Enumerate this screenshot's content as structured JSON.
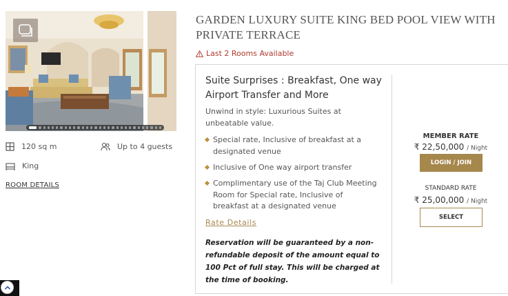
{
  "room": {
    "title": "GARDEN LUXURY SUITE KING BED POOL VIEW WITH PRIVATE TERRACE",
    "availability": "Last 2 Rooms Available",
    "size": "120 sq m",
    "guests": "Up to 4 guests",
    "bed": "King",
    "room_details_link": "ROOM DETAILS",
    "gallery": {
      "total_images": 30,
      "active_index": 0
    }
  },
  "offer": {
    "title": "Suite Surprises : Breakfast, One way Airport Transfer and More",
    "description": "Unwind in style: Luxurious Suites at unbeatable value.",
    "bullets": [
      "Special rate, Inclusive of breakfast at a designated venue",
      "Inclusive of One way airport transfer",
      "Complimentary use of the Taj Club Meeting Room for Special rate, Inclusive of breakfast at a designated venue"
    ],
    "rate_details_link": "Rate Details",
    "note": "Reservation will be guaranteed by a non-refundable deposit of the amount equal to 100 Pct of full stay. This will be charged at the time of booking."
  },
  "rates": {
    "member": {
      "label": "MEMBER RATE",
      "price": "₹ 22,50,000",
      "per": "/ Night",
      "button": "LOGIN / JOIN"
    },
    "standard": {
      "label": "STANDARD RATE",
      "price": "₹ 25,00,000",
      "per": "/ Night",
      "button": "SELECT"
    }
  },
  "colors": {
    "accent_gold": "#a6874c",
    "warning_red": "#b03a2e",
    "border": "#d6d6d6"
  },
  "icons": [
    "gallery-icon",
    "area-icon",
    "guests-icon",
    "bed-icon",
    "warning-icon",
    "chevron-up-icon"
  ]
}
